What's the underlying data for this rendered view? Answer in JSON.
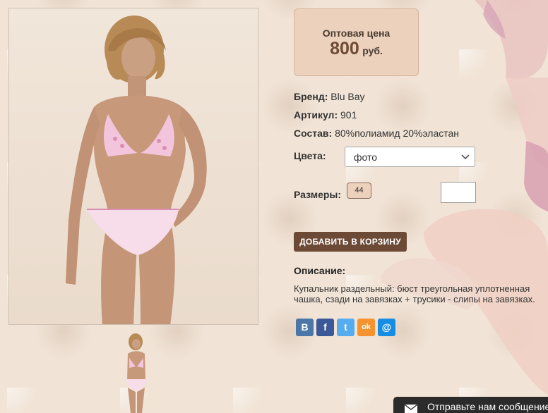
{
  "price": {
    "label": "Оптовая цена",
    "value": "800",
    "unit": "руб."
  },
  "attributes": {
    "brand_label": "Бренд:",
    "brand_value": "Blu Bay",
    "article_label": "Артикул:",
    "article_value": "901",
    "composition_label": "Состав:",
    "composition_value": "80%полиамид 20%эластан"
  },
  "colors": {
    "label": "Цвета:",
    "selected": "фото"
  },
  "sizes": {
    "label": "Размеры:",
    "items": [
      "44"
    ]
  },
  "quantity_value": "",
  "add_to_cart_label": "ДОБАВИТЬ В КОРЗИНУ",
  "description": {
    "title": "Описание:",
    "text": "Купальник раздельный: бюст треугольная уплотненная чашка, сзади на завязках + трусики - слипы на завязках."
  },
  "share": {
    "icons": [
      "vk-icon",
      "facebook-icon",
      "twitter-icon",
      "odnoklassniki-icon",
      "mailru-icon"
    ],
    "labels": [
      "В",
      "f",
      "t",
      "ok",
      "@"
    ],
    "colors": [
      "#4a76a8",
      "#3b5998",
      "#55acee",
      "#f59331",
      "#168de2"
    ]
  },
  "chat": {
    "label": "Отправьте нам сообщение"
  },
  "theme": {
    "accent": "#6c4a36",
    "price_bg": "#ecd2bd"
  }
}
